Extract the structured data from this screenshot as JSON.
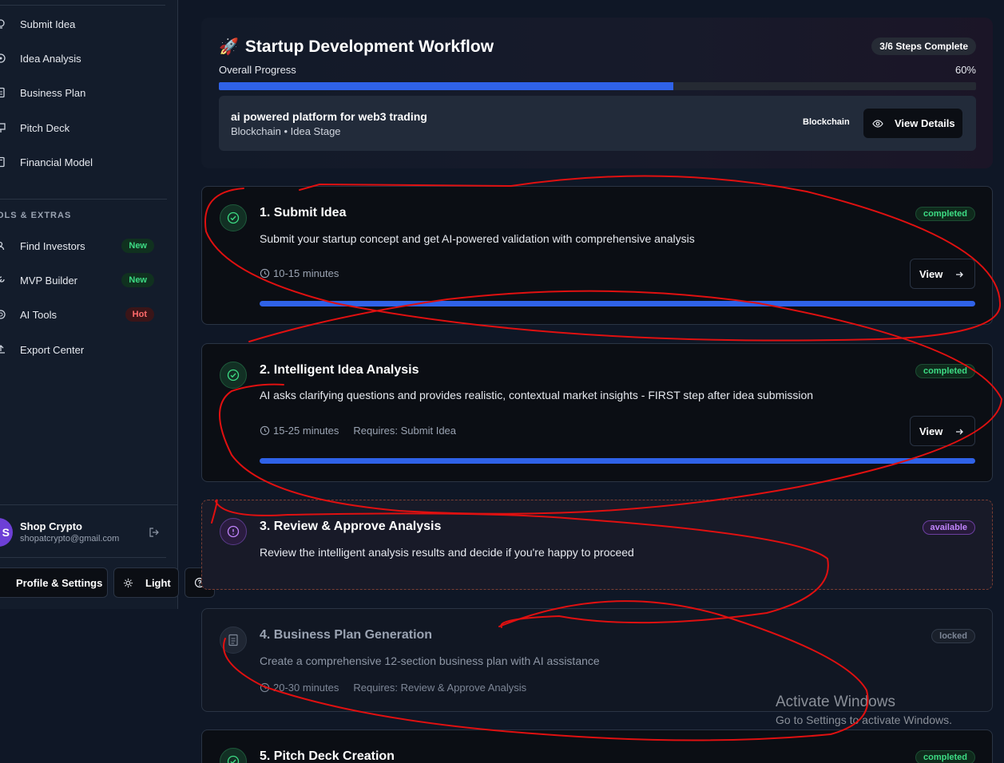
{
  "sidebar": {
    "nav_items": [
      {
        "label": "Submit Idea",
        "icon": "lightbulb-icon"
      },
      {
        "label": "Idea Analysis",
        "icon": "analysis-icon"
      },
      {
        "label": "Business Plan",
        "icon": "document-icon"
      },
      {
        "label": "Pitch Deck",
        "icon": "presentation-icon"
      },
      {
        "label": "Financial Model",
        "icon": "calculator-icon"
      }
    ],
    "section_title": "OLS & EXTRAS",
    "extra_items": [
      {
        "label": "Find Investors",
        "badge": "New",
        "icon": "users-icon"
      },
      {
        "label": "MVP Builder",
        "badge": "New",
        "icon": "wrench-icon"
      },
      {
        "label": "AI Tools",
        "badge": "Hot",
        "icon": "sparkle-icon"
      },
      {
        "label": "Export Center",
        "badge": "",
        "icon": "export-icon"
      }
    ],
    "user": {
      "avatar_letter": "S",
      "name": "Shop Crypto",
      "email": "shopatcrypto@gmail.com"
    },
    "profile_button": "Profile & Settings",
    "theme_button": "Light"
  },
  "workflow": {
    "title": "Startup Development Workflow",
    "steps_complete": "3/6 Steps Complete",
    "progress_label": "Overall Progress",
    "progress_text": "60%",
    "progress_value": 0.6,
    "idea": {
      "title": "ai powered platform for web3 trading",
      "subtitle": "Blockchain • Idea Stage",
      "tag": "Blockchain",
      "view_details": "View Details"
    }
  },
  "steps": [
    {
      "title": "1. Submit Idea",
      "description": "Submit your startup concept and get AI-powered validation with comprehensive analysis",
      "status": "completed",
      "duration": "10-15 minutes",
      "requires": "",
      "view_label": "View"
    },
    {
      "title": "2. Intelligent Idea Analysis",
      "description": "AI asks clarifying questions and provides realistic, contextual market insights - FIRST step after idea submission",
      "status": "completed",
      "duration": "15-25 minutes",
      "requires": "Requires: Submit Idea",
      "view_label": "View"
    },
    {
      "title": "3. Review & Approve Analysis",
      "description": "Review the intelligent analysis results and decide if you're happy to proceed",
      "status": "available"
    },
    {
      "title": "4. Business Plan Generation",
      "description": "Create a comprehensive 12-section business plan with AI assistance",
      "status": "locked",
      "duration": "20-30 minutes",
      "requires": "Requires: Review & Approve Analysis"
    },
    {
      "title": "5. Pitch Deck Creation",
      "status": "completed"
    }
  ],
  "watermark": {
    "line1": "Activate Windows",
    "line2": "Go to Settings to activate Windows."
  },
  "colors": {
    "accent_blue": "#2f62e8",
    "completed_green": "#3ddc84",
    "available_purple": "#c084fc",
    "annotation_red": "#e01010"
  }
}
